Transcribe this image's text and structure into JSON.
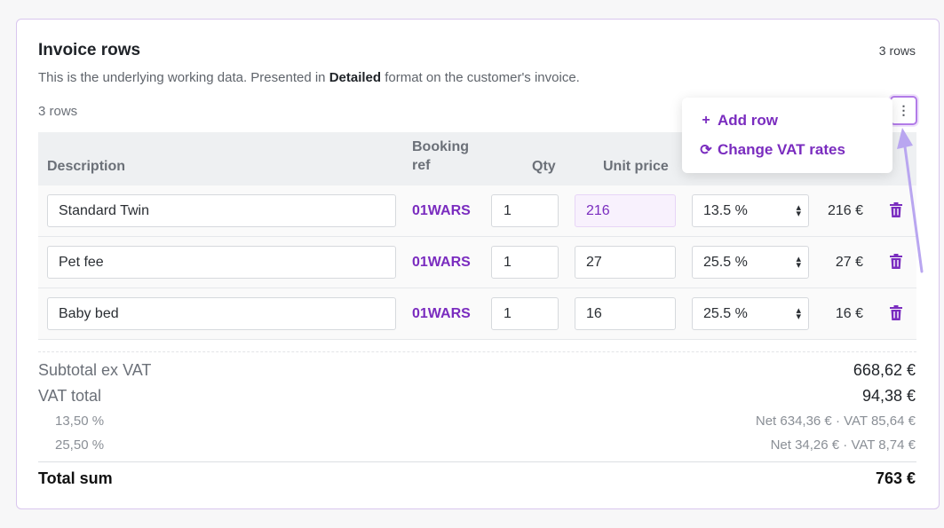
{
  "card": {
    "title": "Invoice rows",
    "rows_count_top": "3 rows",
    "subtitle_pre": "This is the underlying working data. Presented in ",
    "subtitle_bold": "Detailed",
    "subtitle_post": " format on the customer's invoice.",
    "rows_count": "3 rows",
    "kebab_icon": "⋮"
  },
  "table": {
    "headers": {
      "description": "Description",
      "booking_ref_1": "Booking",
      "booking_ref_2": "ref",
      "qty": "Qty",
      "unit_price": "Unit price"
    },
    "rows": [
      {
        "description": "Standard Twin",
        "booking_ref": "01WARS",
        "qty": "1",
        "unit_price": "216",
        "vat": "13.5 %",
        "total": "216 €"
      },
      {
        "description": "Pet fee",
        "booking_ref": "01WARS",
        "qty": "1",
        "unit_price": "27",
        "vat": "25.5 %",
        "total": "27 €"
      },
      {
        "description": "Baby bed",
        "booking_ref": "01WARS",
        "qty": "1",
        "unit_price": "16",
        "vat": "25.5 %",
        "total": "16 €"
      }
    ]
  },
  "summary": {
    "subtotal_label": "Subtotal ex VAT",
    "subtotal_value": "668,62 €",
    "vat_total_label": "VAT total",
    "vat_total_value": "94,38 €",
    "vat_breakdown": [
      {
        "rate": "13,50 %",
        "detail": "Net 634,36 € · VAT 85,64 €"
      },
      {
        "rate": "25,50 %",
        "detail": "Net 34,26 € · VAT 8,74 €"
      }
    ],
    "total_label": "Total sum",
    "total_value": "763 €"
  },
  "menu": {
    "add_row_icon": "+",
    "add_row_label": "Add row",
    "change_vat_icon": "⟳",
    "change_vat_label": "Change VAT rates"
  },
  "colors": {
    "accent": "#7a2cbf",
    "border_accent": "#b27be8",
    "annotation_arrow": "#b9a6f0"
  }
}
